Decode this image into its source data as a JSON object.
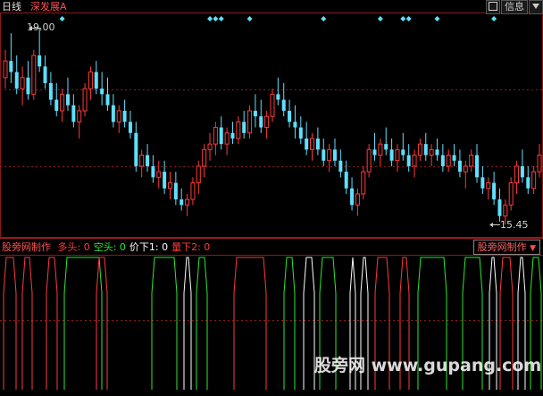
{
  "header": {
    "period_label": "日线",
    "formula_name": "深发展A",
    "info_button": "信息",
    "icon_button": "tile-icon"
  },
  "price_chart": {
    "high_label": "19.00",
    "low_label": "15.45",
    "high_value": 19.0,
    "low_value": 15.45,
    "up_color": "#ff3a3a",
    "down_color": "#5fe0ff",
    "grid_color": "#8a1a1a"
  },
  "indicator": {
    "title": "股旁网制作",
    "selector_label": "股旁网制作",
    "fields": [
      {
        "label": "多头:",
        "value": "0",
        "color": "#ff3a3a"
      },
      {
        "label": "空头:",
        "value": "0",
        "color": "#2ee82e"
      },
      {
        "label": "价下1:",
        "value": "0",
        "color": "#ffffff"
      },
      {
        "label": "量下2:",
        "value": "0",
        "color": "#ff3a3a"
      }
    ]
  },
  "watermark": {
    "text": "股旁网 www.gupang.com"
  },
  "chart_data": {
    "type": "candlestick",
    "ohlc": [
      [
        18.1,
        18.6,
        17.9,
        18.4
      ],
      [
        18.4,
        18.9,
        18.0,
        18.2
      ],
      [
        18.2,
        18.5,
        17.8,
        17.9
      ],
      [
        17.9,
        18.3,
        17.6,
        18.1
      ],
      [
        18.1,
        18.4,
        17.7,
        17.8
      ],
      [
        17.8,
        18.6,
        17.7,
        18.5
      ],
      [
        18.5,
        19.0,
        18.2,
        18.3
      ],
      [
        18.3,
        18.5,
        17.9,
        18.0
      ],
      [
        18.0,
        18.2,
        17.6,
        17.7
      ],
      [
        17.7,
        18.0,
        17.4,
        17.5
      ],
      [
        17.5,
        17.9,
        17.3,
        17.8
      ],
      [
        17.8,
        18.1,
        17.5,
        17.6
      ],
      [
        17.6,
        17.8,
        17.2,
        17.3
      ],
      [
        17.3,
        17.6,
        17.0,
        17.5
      ],
      [
        17.5,
        18.0,
        17.4,
        17.9
      ],
      [
        17.9,
        18.3,
        17.7,
        18.2
      ],
      [
        18.2,
        18.4,
        17.8,
        17.9
      ],
      [
        17.9,
        18.2,
        17.6,
        17.8
      ],
      [
        17.8,
        18.1,
        17.5,
        17.6
      ],
      [
        17.6,
        17.8,
        17.2,
        17.3
      ],
      [
        17.3,
        17.6,
        17.1,
        17.5
      ],
      [
        17.5,
        17.7,
        17.2,
        17.3
      ],
      [
        17.3,
        17.5,
        17.0,
        17.1
      ],
      [
        17.1,
        17.3,
        16.4,
        16.5
      ],
      [
        16.5,
        16.8,
        16.3,
        16.7
      ],
      [
        16.7,
        16.9,
        16.4,
        16.5
      ],
      [
        16.5,
        16.7,
        16.2,
        16.3
      ],
      [
        16.3,
        16.6,
        16.1,
        16.4
      ],
      [
        16.4,
        16.6,
        16.0,
        16.1
      ],
      [
        16.1,
        16.4,
        15.9,
        16.2
      ],
      [
        16.2,
        16.4,
        15.8,
        15.9
      ],
      [
        15.9,
        16.1,
        15.7,
        15.8
      ],
      [
        15.8,
        16.0,
        15.6,
        15.9
      ],
      [
        15.9,
        16.3,
        15.8,
        16.2
      ],
      [
        16.2,
        16.6,
        16.0,
        16.5
      ],
      [
        16.5,
        16.9,
        16.3,
        16.8
      ],
      [
        16.8,
        17.1,
        16.6,
        16.9
      ],
      [
        16.9,
        17.3,
        16.7,
        17.2
      ],
      [
        17.2,
        17.4,
        16.8,
        16.9
      ],
      [
        16.9,
        17.2,
        16.7,
        17.1
      ],
      [
        17.1,
        17.3,
        16.9,
        17.0
      ],
      [
        17.0,
        17.4,
        16.9,
        17.3
      ],
      [
        17.3,
        17.5,
        17.0,
        17.1
      ],
      [
        17.1,
        17.6,
        17.0,
        17.5
      ],
      [
        17.5,
        17.8,
        17.2,
        17.4
      ],
      [
        17.4,
        17.7,
        17.1,
        17.2
      ],
      [
        17.2,
        17.5,
        17.0,
        17.4
      ],
      [
        17.4,
        17.9,
        17.3,
        17.8
      ],
      [
        17.8,
        18.1,
        17.6,
        17.7
      ],
      [
        17.7,
        18.0,
        17.4,
        17.5
      ],
      [
        17.5,
        17.7,
        17.2,
        17.3
      ],
      [
        17.3,
        17.6,
        17.0,
        17.2
      ],
      [
        17.2,
        17.4,
        16.9,
        17.0
      ],
      [
        17.0,
        17.3,
        16.7,
        16.8
      ],
      [
        16.8,
        17.1,
        16.6,
        17.0
      ],
      [
        17.0,
        17.2,
        16.7,
        16.8
      ],
      [
        16.8,
        17.0,
        16.5,
        16.6
      ],
      [
        16.6,
        16.9,
        16.4,
        16.8
      ],
      [
        16.8,
        17.0,
        16.5,
        16.6
      ],
      [
        16.6,
        16.8,
        16.3,
        16.4
      ],
      [
        16.4,
        16.6,
        16.0,
        16.1
      ],
      [
        16.1,
        16.3,
        15.7,
        15.8
      ],
      [
        15.8,
        16.1,
        15.6,
        16.0
      ],
      [
        16.0,
        16.5,
        15.9,
        16.4
      ],
      [
        16.4,
        16.9,
        16.3,
        16.8
      ],
      [
        16.8,
        17.1,
        16.6,
        16.7
      ],
      [
        16.7,
        17.0,
        16.5,
        16.9
      ],
      [
        16.9,
        17.2,
        16.7,
        16.8
      ],
      [
        16.8,
        17.0,
        16.5,
        16.6
      ],
      [
        16.6,
        16.9,
        16.4,
        16.8
      ],
      [
        16.8,
        17.1,
        16.6,
        16.7
      ],
      [
        16.7,
        16.9,
        16.4,
        16.5
      ],
      [
        16.5,
        16.8,
        16.3,
        16.7
      ],
      [
        16.7,
        17.0,
        16.6,
        16.9
      ],
      [
        16.9,
        17.1,
        16.6,
        16.7
      ],
      [
        16.7,
        16.9,
        16.5,
        16.8
      ],
      [
        16.8,
        17.0,
        16.6,
        16.7
      ],
      [
        16.7,
        16.9,
        16.4,
        16.5
      ],
      [
        16.5,
        16.8,
        16.4,
        16.7
      ],
      [
        16.7,
        16.9,
        16.5,
        16.6
      ],
      [
        16.6,
        16.8,
        16.3,
        16.4
      ],
      [
        16.4,
        16.6,
        16.1,
        16.5
      ],
      [
        16.5,
        16.8,
        16.4,
        16.7
      ],
      [
        16.7,
        16.9,
        16.2,
        16.3
      ],
      [
        16.3,
        16.5,
        16.0,
        16.1
      ],
      [
        16.1,
        16.3,
        15.9,
        16.2
      ],
      [
        16.2,
        16.4,
        15.8,
        15.9
      ],
      [
        15.9,
        16.1,
        15.5,
        15.6
      ],
      [
        15.6,
        15.9,
        15.45,
        15.8
      ],
      [
        15.8,
        16.3,
        15.7,
        16.2
      ],
      [
        16.2,
        16.6,
        16.0,
        16.5
      ],
      [
        16.5,
        16.8,
        16.2,
        16.3
      ],
      [
        16.3,
        16.5,
        16.0,
        16.1
      ],
      [
        16.1,
        16.5,
        16.0,
        16.4
      ],
      [
        16.4,
        16.9,
        16.3,
        16.7
      ]
    ],
    "signal_markers": [
      10,
      36,
      37,
      38,
      43,
      56,
      66,
      70,
      71,
      76,
      86
    ]
  }
}
